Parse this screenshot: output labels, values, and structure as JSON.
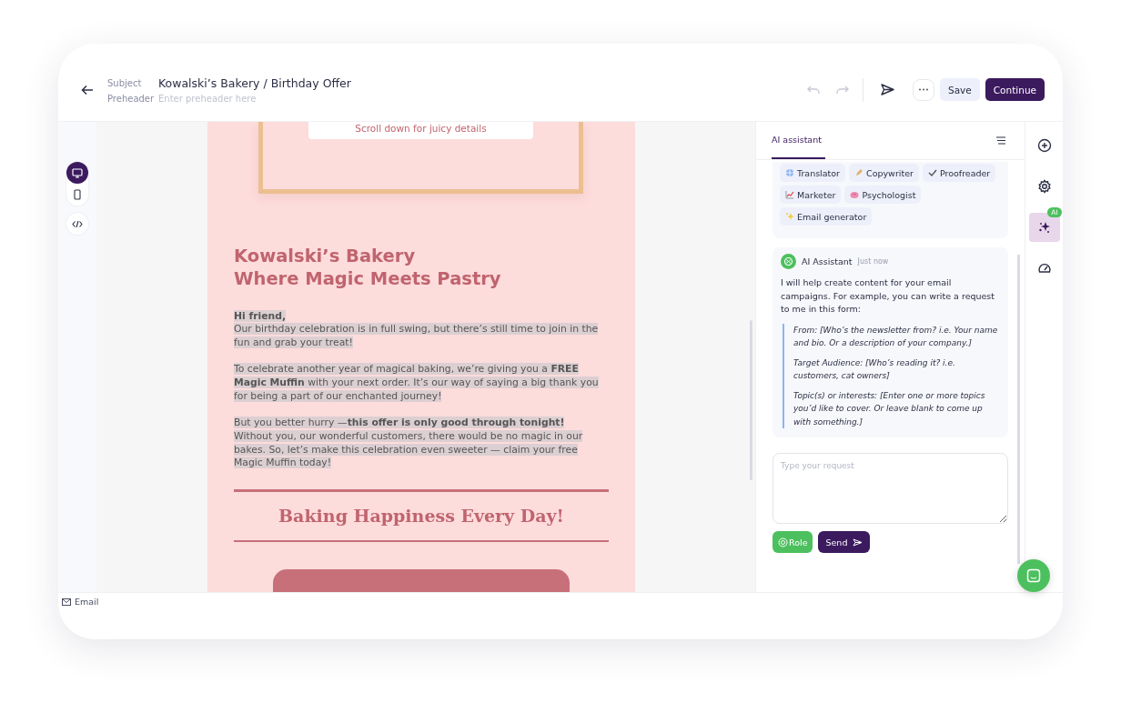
{
  "header": {
    "subject_label": "Subject",
    "subject": "Kowalski’s Bakery / Birthday Offer",
    "preheader_label": "Preheader",
    "preheader_placeholder": "Enter preheader here",
    "history": [
      {
        "kind": "undo",
        "disabled": true
      },
      {
        "kind": "redo",
        "disabled": true
      }
    ],
    "save": "Save",
    "continue": "Continue"
  },
  "view_toggles": [
    {
      "kind": "desktop",
      "selected": true
    },
    {
      "kind": "mobile",
      "selected": false
    }
  ],
  "email": {
    "banner_text": "Scroll down for juicy details",
    "heading": [
      "Kowalski’s Bakery",
      "Where Magic Meets Pastry"
    ],
    "paragraphs": [
      {
        "highlighted": true,
        "lines": [
          "**Hi friend,**",
          "Our birthday celebration is in full swing, but there’s still time to join in the fun and grab your treat!"
        ]
      },
      {
        "highlighted": true,
        "lines": [
          "To celebrate another year of magical baking, we’re giving you a **FREE Magic Muffin** with your next order. It’s our way of saying a big thank you for being a part of our enchanted journey!"
        ]
      },
      {
        "highlighted": true,
        "lines": [
          "But you better hurry —**this offer is only good through tonight!**",
          "Without you, our wonderful customers, there would be no magic in our bakes. So, let’s make this celebration even sweeter — claim your free Magic Muffin today!"
        ]
      }
    ],
    "tagline": "Baking Happiness Every Day!"
  },
  "assistant": {
    "tab": "AI assistant",
    "roles": [
      {
        "kind": "globe",
        "label": "Translator"
      },
      {
        "kind": "pen",
        "label": "Copywriter"
      },
      {
        "kind": "check",
        "label": "Proofreader"
      },
      {
        "kind": "chart",
        "label": "Marketer"
      },
      {
        "kind": "brain",
        "label": "Psychologist"
      },
      {
        "kind": "sparkle",
        "label": "Email generator"
      }
    ],
    "message": {
      "author": "AI Assistant",
      "time": "Just now",
      "text": "I will help create content for your email campaigns. For example, you can write a request to me in this form:",
      "quote": [
        "From: [Who’s the newsletter from? i.e. Your name and bio. Or a description of your company.]",
        "Target Audience: [Who’s reading it? i.e. customers, cat owners]",
        "Topic(s) or interests: [Enter one or more topics you’d like to cover. Or leave blank to come up with something.]"
      ]
    },
    "input_placeholder": "Type your request",
    "role_button": "Role",
    "send_button": "Send"
  },
  "rail": [
    {
      "kind": "add",
      "selected": false
    },
    {
      "kind": "settings",
      "selected": false
    },
    {
      "kind": "ai",
      "selected": true,
      "badge": "AI"
    },
    {
      "kind": "speed",
      "selected": false
    }
  ],
  "footer": {
    "breadcrumb": "Email"
  }
}
